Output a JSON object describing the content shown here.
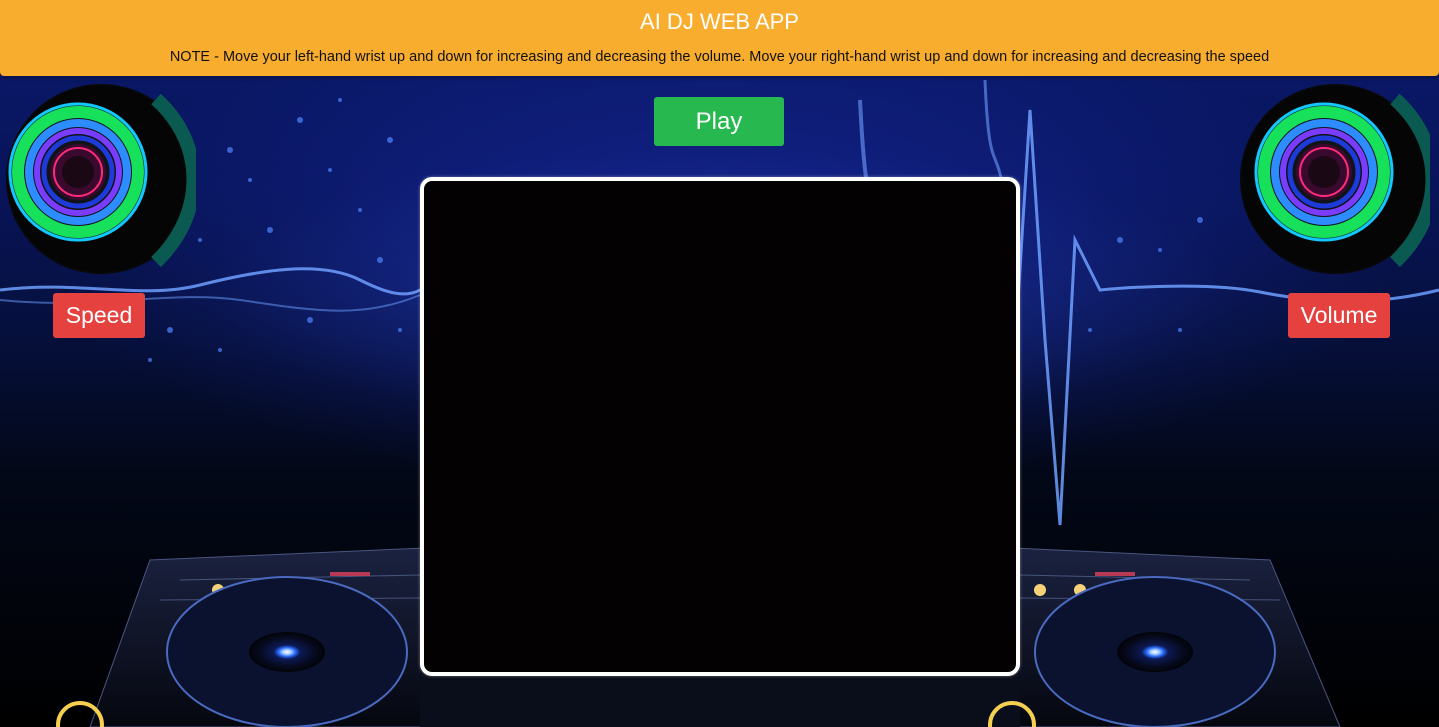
{
  "header": {
    "title": "AI DJ WEB APP",
    "note": "NOTE - Move your left-hand wrist up and down for increasing and decreasing the volume. Move your right-hand wrist up and down for increasing and decreasing the speed"
  },
  "controls": {
    "play_label": "Play",
    "speed_label": "Speed",
    "volume_label": "Volume"
  },
  "colors": {
    "header_bg": "#f8ad2f",
    "play_bg": "#27b84f",
    "badge_bg": "#e5413f",
    "video_border": "#ffffff"
  },
  "icons": {
    "left_speaker": "speaker-icon",
    "right_speaker": "speaker-icon",
    "left_turntable": "turntable-icon",
    "right_turntable": "turntable-icon"
  }
}
